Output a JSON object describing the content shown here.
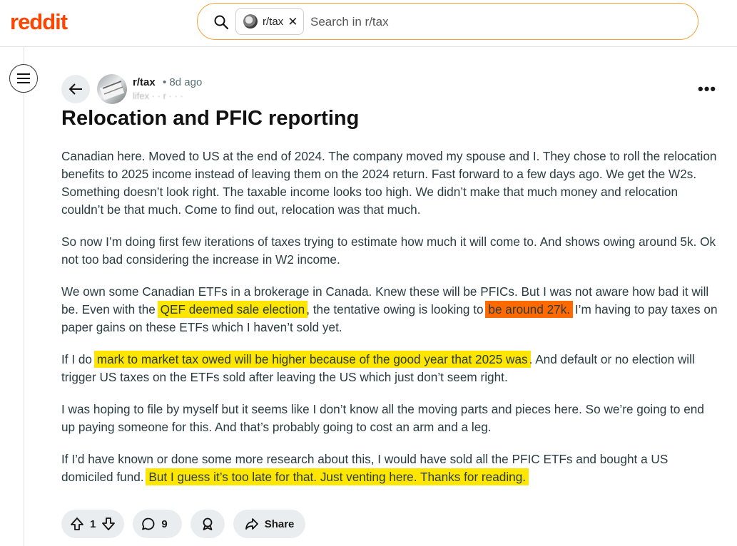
{
  "header": {
    "logo": "reddit",
    "search_chip_label": "r/tax",
    "search_chip_close": "✕",
    "search_placeholder": "Search in r/tax"
  },
  "post": {
    "subreddit": "r/tax",
    "age": "• 8d ago",
    "flair": "lifex · · r · · ·",
    "more": "•••",
    "title": "Relocation and PFIC reporting",
    "p1": "Canadian here. Moved to US at the end of 2024. The company moved my spouse and I. They chose to roll the relocation benefits to 2025 income instead of leaving them on the 2024 return. Fast forward to a few days ago. We get the W2s. Something doesn’t look right. The taxable income looks too high. We didn’t make that much money and relocation couldn’t be that much. Come to find out, relocation was that much.",
    "p2": "So now I’m doing first few iterations of taxes trying to estimate how much it will come to. And shows owing around 5k. Ok not too bad considering the increase in W2 income.",
    "p3a": "We own some Canadian ETFs in a brokerage in Canada. Knew these will be PFICs. But I was not aware how bad it will be. Even with the ",
    "p3b": "QEF deemed sale election",
    "p3c": ", the tentative owing is looking to ",
    "p3d": "be around 27k.",
    "p3e": " I’m having to pay taxes on paper gains on these ETFs which I haven’t sold yet.",
    "p4a": "If I do ",
    "p4b": "mark to market tax owed will be higher because of the good year that 2025 was",
    "p4c": ". And default or no election will trigger US taxes on the ETFs sold after leaving the US which just don’t seem right.",
    "p5": "I was hoping to file by myself but it seems like I don’t know all the moving parts and pieces here. So we’re going to end up paying someone for this. And that’s probably going to cost an arm and a leg.",
    "p6a": "If I’d have known or done some more research about this, I would have sold all the PFIC ETFs and bought a US domiciled fund. ",
    "p6b": "But I guess it’s too late for that. Just venting here. Thanks for reading."
  },
  "actions": {
    "votes": "1",
    "comments": "9",
    "share": "Share"
  },
  "colors": {
    "brand": "#ff4500",
    "highlight_yellow": "#ffe600",
    "highlight_orange": "#ff6a00"
  }
}
